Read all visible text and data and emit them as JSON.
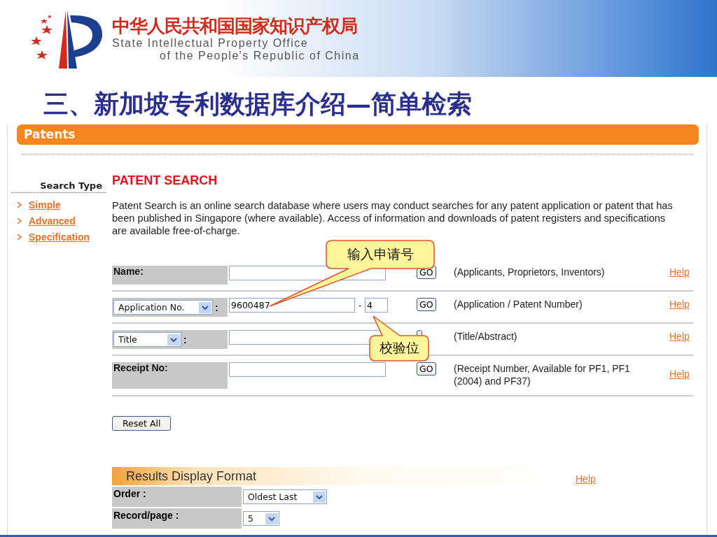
{
  "header": {
    "org_name_cn": "中华人民共和国国家知识产权局",
    "org_name_en_1": "State Intellectual Property Office",
    "org_name_en_2": "of the People's Republic of China"
  },
  "slide_title": "三、新加坡专利数据库介绍—简单检索",
  "page": {
    "section_bar": "Patents",
    "sidebar": {
      "heading": "Search Type",
      "links": [
        {
          "label": "Simple"
        },
        {
          "label": "Advanced"
        },
        {
          "label": "Specification"
        }
      ]
    },
    "heading": "PATENT SEARCH",
    "intro": "Patent Search is an online search database where users may conduct searches for any patent application or patent that has been published in Singapore (where available). Access of information and downloads of patent registers and specifications are available free-of-charge.",
    "search_rows": [
      {
        "kind": "label",
        "label": "Name:",
        "go": "GO",
        "description": "(Applicants, Proprietors, Inventors)",
        "help": "Help"
      },
      {
        "kind": "select",
        "label": "Application No.",
        "separator": ":",
        "value": "9600487",
        "check_separator": "-",
        "check_digit": "4",
        "go": "GO",
        "description": "(Application / Patent Number)",
        "help": "Help"
      },
      {
        "kind": "select",
        "label": "Title",
        "separator": ":",
        "description": "(Title/Abstract)",
        "help": "Help"
      },
      {
        "kind": "label",
        "label": "Receipt No:",
        "go": "GO",
        "description": "(Receipt Number, Available for PF1, PF1 (2004) and PF37)",
        "help": "Help"
      }
    ],
    "reset_button": "Reset All",
    "results_format": {
      "title": "Results Display Format",
      "help": "Help",
      "options": [
        {
          "label": "Order :",
          "value": "Oldest Last"
        },
        {
          "label": "Record/page :",
          "value": "5"
        }
      ]
    }
  },
  "callouts": [
    {
      "text": "输入申请号"
    },
    {
      "text": "校验位"
    }
  ]
}
